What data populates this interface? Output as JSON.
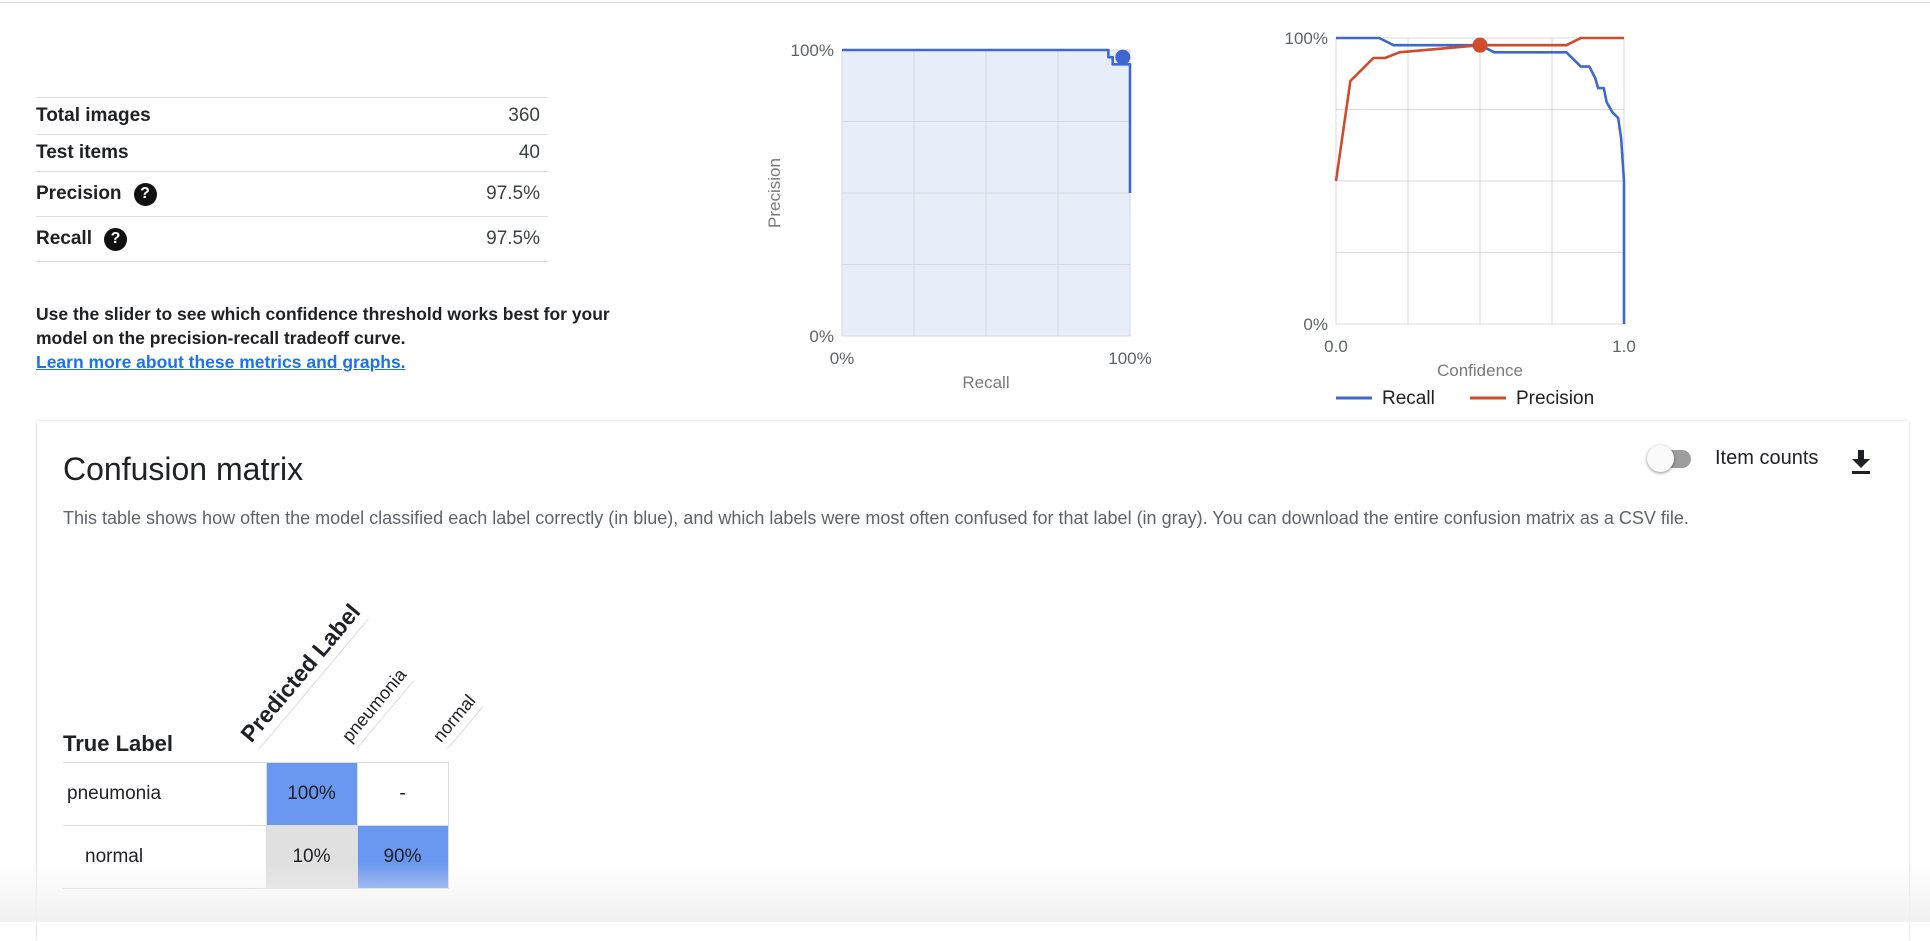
{
  "metrics": [
    {
      "label": "Total images",
      "value": "360",
      "help": false
    },
    {
      "label": "Test items",
      "value": "40",
      "help": false
    },
    {
      "label": "Precision",
      "value": "97.5%",
      "help": true
    },
    {
      "label": "Recall",
      "value": "97.5%",
      "help": true
    }
  ],
  "help_glyph": "?",
  "explanation": {
    "text": "Use the slider to see which confidence threshold works best for your model on the precision-recall tradeoff curve.",
    "link": "Learn more about these metrics and graphs."
  },
  "chart_data": [
    {
      "type": "line",
      "xlabel": "Recall",
      "ylabel": "Precision",
      "x_ticks": [
        "0%",
        "100%"
      ],
      "y_ticks": [
        "0%",
        "100%"
      ],
      "xlim": [
        0,
        1
      ],
      "ylim": [
        0,
        1
      ],
      "grid": true,
      "fill": "#e8eef9",
      "series": [
        {
          "color": "#3f67d0",
          "x": [
            0.0,
            0.925,
            0.925,
            0.94,
            0.94,
            0.975,
            0.975,
            1.0,
            1.0
          ],
          "y": [
            1.0,
            1.0,
            0.975,
            0.975,
            0.95,
            0.95,
            0.95,
            0.95,
            0.5
          ]
        }
      ],
      "marker": {
        "x": 0.975,
        "y": 0.975,
        "color": "#3f67d0"
      }
    },
    {
      "type": "line",
      "xlabel": "Confidence",
      "ylabel": "",
      "x_ticks": [
        "0.0",
        "1.0"
      ],
      "y_ticks": [
        "0%",
        "100%"
      ],
      "xlim": [
        0,
        1
      ],
      "ylim": [
        0,
        1
      ],
      "grid": true,
      "legend_position": "bottom",
      "series": [
        {
          "name": "Recall",
          "color": "#3f67d0",
          "x": [
            0.0,
            0.15,
            0.2,
            0.5,
            0.55,
            0.8,
            0.85,
            0.88,
            0.9,
            0.91,
            0.93,
            0.94,
            0.96,
            0.98,
            0.99,
            1.0,
            1.0
          ],
          "y": [
            1.0,
            1.0,
            0.975,
            0.975,
            0.95,
            0.95,
            0.9,
            0.9,
            0.86,
            0.825,
            0.825,
            0.775,
            0.74,
            0.72,
            0.65,
            0.5,
            0.0
          ]
        },
        {
          "name": "Precision",
          "color": "#d14a2b",
          "x": [
            0.0,
            0.05,
            0.13,
            0.17,
            0.22,
            0.5,
            0.8,
            0.85,
            1.0
          ],
          "y": [
            0.5,
            0.85,
            0.93,
            0.93,
            0.95,
            0.975,
            0.975,
            1.0,
            1.0
          ]
        }
      ],
      "marker": {
        "x": 0.5,
        "y": 0.975,
        "color": "#d14a2b"
      }
    }
  ],
  "confusion": {
    "title": "Confusion matrix",
    "description": "This table shows how often the model classified each label correctly (in blue), and which labels were most often confused for that label (in gray). You can download the entire confusion matrix as a CSV file.",
    "toggle_label": "Item counts",
    "toggle_on": false,
    "download_icon": "download-icon",
    "true_label": "True Label",
    "predicted_label": "Predicted Label",
    "columns": [
      "pneumonia",
      "normal"
    ],
    "rows": [
      {
        "label": "pneumonia",
        "cells": [
          {
            "text": "100%",
            "kind": "blue"
          },
          {
            "text": "-",
            "kind": "white"
          }
        ]
      },
      {
        "label": "normal",
        "cells": [
          {
            "text": "10%",
            "kind": "gray"
          },
          {
            "text": "90%",
            "kind": "blue"
          }
        ]
      }
    ]
  }
}
